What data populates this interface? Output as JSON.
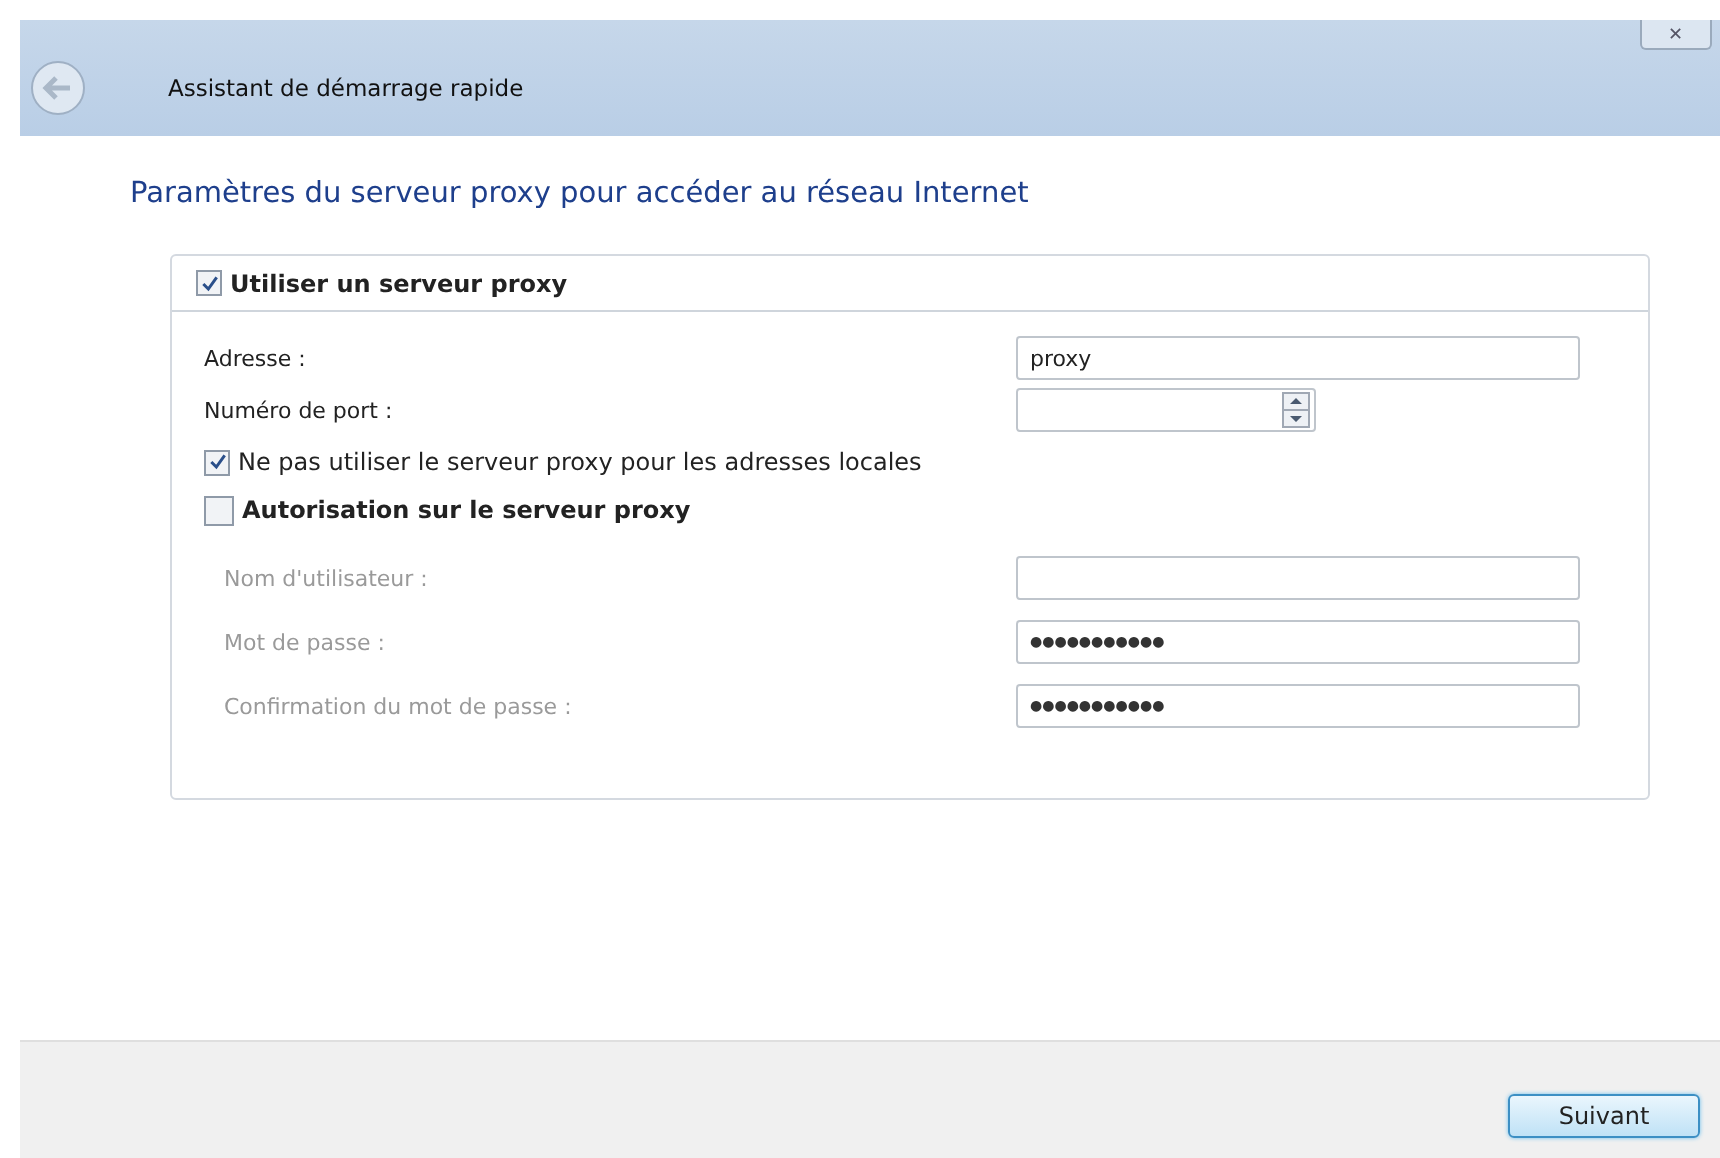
{
  "window": {
    "title": "Assistant de démarrage rapide",
    "close": "✕"
  },
  "heading": "Paramètres du serveur proxy pour accéder au réseau Internet",
  "proxy_group": {
    "label": "Utiliser un serveur proxy",
    "checked": true,
    "fields": [
      {
        "label": "Adresse :",
        "value": "proxy",
        "kind": "text",
        "disabled": false
      },
      {
        "label": "Numéro de port :",
        "kind": "spin",
        "disabled": false
      }
    ],
    "local_bypass": {
      "label": "Ne pas utiliser le serveur proxy pour les adresses locales",
      "checked": true
    },
    "auth": {
      "label": "Autorisation sur le serveur proxy",
      "checked": false,
      "fields": [
        {
          "label": "Nom d'utilisateur :",
          "kind": "text",
          "disabled": true
        },
        {
          "label": "Mot de passe :",
          "value": "●●●●●●●●●●●",
          "kind": "text",
          "disabled": true
        },
        {
          "label": "Confirmation du mot de passe :",
          "value": "●●●●●●●●●●●",
          "kind": "text",
          "disabled": true
        }
      ]
    }
  },
  "buttons": [
    {
      "label": "Suivant"
    }
  ]
}
